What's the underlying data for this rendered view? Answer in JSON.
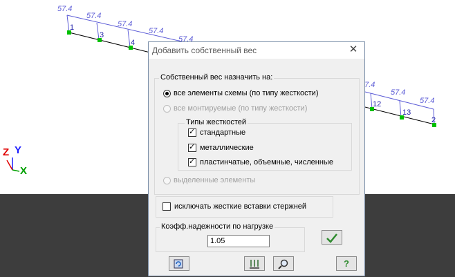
{
  "scheme": {
    "load_values": [
      "57.4",
      "57.4",
      "57.4",
      "57.4",
      "57.4",
      "57.4",
      "57.4",
      "57.4"
    ],
    "node_labels": [
      "1",
      "3",
      "4",
      "12",
      "13",
      "2"
    ],
    "axis": {
      "z": "Z",
      "y": "Y",
      "x": "X"
    }
  },
  "dialog": {
    "title": "Добавить собственный вес",
    "close_symbol": "✕",
    "assign_group_title": "Собственный вес назначить на:",
    "options": {
      "all_elements": "все элементы схемы (по типу жесткости)",
      "mounted": "все монтируемые (по типу жесткости)",
      "selected": "выделенные элементы"
    },
    "stiffness_group_title": "Типы жесткостей",
    "stiffness_types": {
      "standard": "стандартные",
      "metal": "металлические",
      "plate": "пластинчатые, объемные, численные"
    },
    "exclude_label": "исключать жесткие вставки стержней",
    "factor_group_title": "Коэфф.надежности по нагрузке",
    "factor_value": "1.05",
    "help_symbol": "?"
  },
  "colors": {
    "node": "#00c000",
    "load_line": "#6a5acd",
    "label": "#2222aa"
  }
}
